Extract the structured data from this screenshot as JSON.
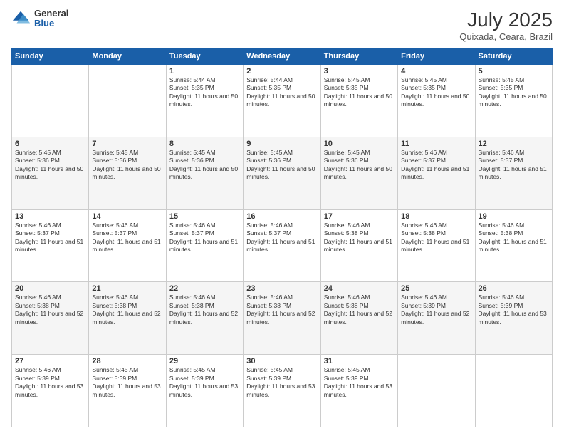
{
  "header": {
    "logo_general": "General",
    "logo_blue": "Blue",
    "month_title": "July 2025",
    "subtitle": "Quixada, Ceara, Brazil"
  },
  "calendar": {
    "weekdays": [
      "Sunday",
      "Monday",
      "Tuesday",
      "Wednesday",
      "Thursday",
      "Friday",
      "Saturday"
    ],
    "weeks": [
      [
        {
          "day": "",
          "info": ""
        },
        {
          "day": "",
          "info": ""
        },
        {
          "day": "1",
          "info": "Sunrise: 5:44 AM\nSunset: 5:35 PM\nDaylight: 11 hours and 50 minutes."
        },
        {
          "day": "2",
          "info": "Sunrise: 5:44 AM\nSunset: 5:35 PM\nDaylight: 11 hours and 50 minutes."
        },
        {
          "day": "3",
          "info": "Sunrise: 5:45 AM\nSunset: 5:35 PM\nDaylight: 11 hours and 50 minutes."
        },
        {
          "day": "4",
          "info": "Sunrise: 5:45 AM\nSunset: 5:35 PM\nDaylight: 11 hours and 50 minutes."
        },
        {
          "day": "5",
          "info": "Sunrise: 5:45 AM\nSunset: 5:35 PM\nDaylight: 11 hours and 50 minutes."
        }
      ],
      [
        {
          "day": "6",
          "info": "Sunrise: 5:45 AM\nSunset: 5:36 PM\nDaylight: 11 hours and 50 minutes."
        },
        {
          "day": "7",
          "info": "Sunrise: 5:45 AM\nSunset: 5:36 PM\nDaylight: 11 hours and 50 minutes."
        },
        {
          "day": "8",
          "info": "Sunrise: 5:45 AM\nSunset: 5:36 PM\nDaylight: 11 hours and 50 minutes."
        },
        {
          "day": "9",
          "info": "Sunrise: 5:45 AM\nSunset: 5:36 PM\nDaylight: 11 hours and 50 minutes."
        },
        {
          "day": "10",
          "info": "Sunrise: 5:45 AM\nSunset: 5:36 PM\nDaylight: 11 hours and 50 minutes."
        },
        {
          "day": "11",
          "info": "Sunrise: 5:46 AM\nSunset: 5:37 PM\nDaylight: 11 hours and 51 minutes."
        },
        {
          "day": "12",
          "info": "Sunrise: 5:46 AM\nSunset: 5:37 PM\nDaylight: 11 hours and 51 minutes."
        }
      ],
      [
        {
          "day": "13",
          "info": "Sunrise: 5:46 AM\nSunset: 5:37 PM\nDaylight: 11 hours and 51 minutes."
        },
        {
          "day": "14",
          "info": "Sunrise: 5:46 AM\nSunset: 5:37 PM\nDaylight: 11 hours and 51 minutes."
        },
        {
          "day": "15",
          "info": "Sunrise: 5:46 AM\nSunset: 5:37 PM\nDaylight: 11 hours and 51 minutes."
        },
        {
          "day": "16",
          "info": "Sunrise: 5:46 AM\nSunset: 5:37 PM\nDaylight: 11 hours and 51 minutes."
        },
        {
          "day": "17",
          "info": "Sunrise: 5:46 AM\nSunset: 5:38 PM\nDaylight: 11 hours and 51 minutes."
        },
        {
          "day": "18",
          "info": "Sunrise: 5:46 AM\nSunset: 5:38 PM\nDaylight: 11 hours and 51 minutes."
        },
        {
          "day": "19",
          "info": "Sunrise: 5:46 AM\nSunset: 5:38 PM\nDaylight: 11 hours and 51 minutes."
        }
      ],
      [
        {
          "day": "20",
          "info": "Sunrise: 5:46 AM\nSunset: 5:38 PM\nDaylight: 11 hours and 52 minutes."
        },
        {
          "day": "21",
          "info": "Sunrise: 5:46 AM\nSunset: 5:38 PM\nDaylight: 11 hours and 52 minutes."
        },
        {
          "day": "22",
          "info": "Sunrise: 5:46 AM\nSunset: 5:38 PM\nDaylight: 11 hours and 52 minutes."
        },
        {
          "day": "23",
          "info": "Sunrise: 5:46 AM\nSunset: 5:38 PM\nDaylight: 11 hours and 52 minutes."
        },
        {
          "day": "24",
          "info": "Sunrise: 5:46 AM\nSunset: 5:38 PM\nDaylight: 11 hours and 52 minutes."
        },
        {
          "day": "25",
          "info": "Sunrise: 5:46 AM\nSunset: 5:39 PM\nDaylight: 11 hours and 52 minutes."
        },
        {
          "day": "26",
          "info": "Sunrise: 5:46 AM\nSunset: 5:39 PM\nDaylight: 11 hours and 53 minutes."
        }
      ],
      [
        {
          "day": "27",
          "info": "Sunrise: 5:46 AM\nSunset: 5:39 PM\nDaylight: 11 hours and 53 minutes."
        },
        {
          "day": "28",
          "info": "Sunrise: 5:45 AM\nSunset: 5:39 PM\nDaylight: 11 hours and 53 minutes."
        },
        {
          "day": "29",
          "info": "Sunrise: 5:45 AM\nSunset: 5:39 PM\nDaylight: 11 hours and 53 minutes."
        },
        {
          "day": "30",
          "info": "Sunrise: 5:45 AM\nSunset: 5:39 PM\nDaylight: 11 hours and 53 minutes."
        },
        {
          "day": "31",
          "info": "Sunrise: 5:45 AM\nSunset: 5:39 PM\nDaylight: 11 hours and 53 minutes."
        },
        {
          "day": "",
          "info": ""
        },
        {
          "day": "",
          "info": ""
        }
      ]
    ]
  }
}
